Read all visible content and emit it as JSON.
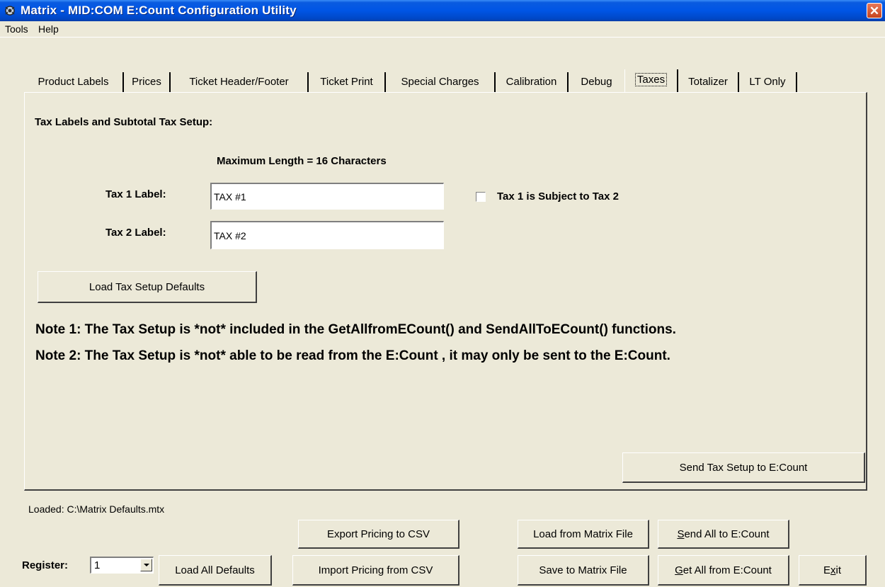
{
  "window": {
    "title": "Matrix - MID:COM E:Count Configuration Utility",
    "close_glyph": "✕"
  },
  "menu": {
    "items": [
      "Tools",
      "Help"
    ]
  },
  "tabs": [
    "Product Labels",
    "Prices",
    "Ticket Header/Footer",
    "Ticket Print",
    "Special Charges",
    "Calibration",
    "Debug",
    "Taxes",
    "Totalizer",
    "LT Only"
  ],
  "active_tab": "Taxes",
  "taxes": {
    "section_title": "Tax Labels and Subtotal Tax Setup:",
    "max_length_label": "Maximum Length = 16 Characters",
    "tax1_label": "Tax 1 Label:",
    "tax1_value": "TAX #1",
    "tax2_label": "Tax 2 Label:",
    "tax2_value": "TAX #2",
    "subject_checkbox_label": "Tax 1 is Subject to Tax 2",
    "subject_checked": false,
    "load_defaults_button": "Load Tax Setup Defaults",
    "note1": "Note 1: The Tax Setup is *not* included in the GetAllfromECount() and SendAllToECount() functions.",
    "note2": "Note 2: The Tax Setup is *not* able to be read from the E:Count , it may only be sent to the E:Count.",
    "send_button": "Send Tax Setup to E:Count"
  },
  "footer": {
    "loaded_status": "Loaded: C:\\Matrix Defaults.mtx",
    "register_label": "Register:",
    "register_value": "1",
    "load_all_defaults": "Load All Defaults",
    "export_csv": "Export Pricing to CSV",
    "import_csv": "Import Pricing from CSV",
    "load_matrix_file": "Load from Matrix File",
    "save_matrix_file": "Save to Matrix File",
    "send_all_prefix": "S",
    "send_all_rest": "end All to E:Count",
    "get_all_prefix": "G",
    "get_all_rest": "et All from E:Count",
    "exit_a": "E",
    "exit_u": "x",
    "exit_b": "it"
  }
}
